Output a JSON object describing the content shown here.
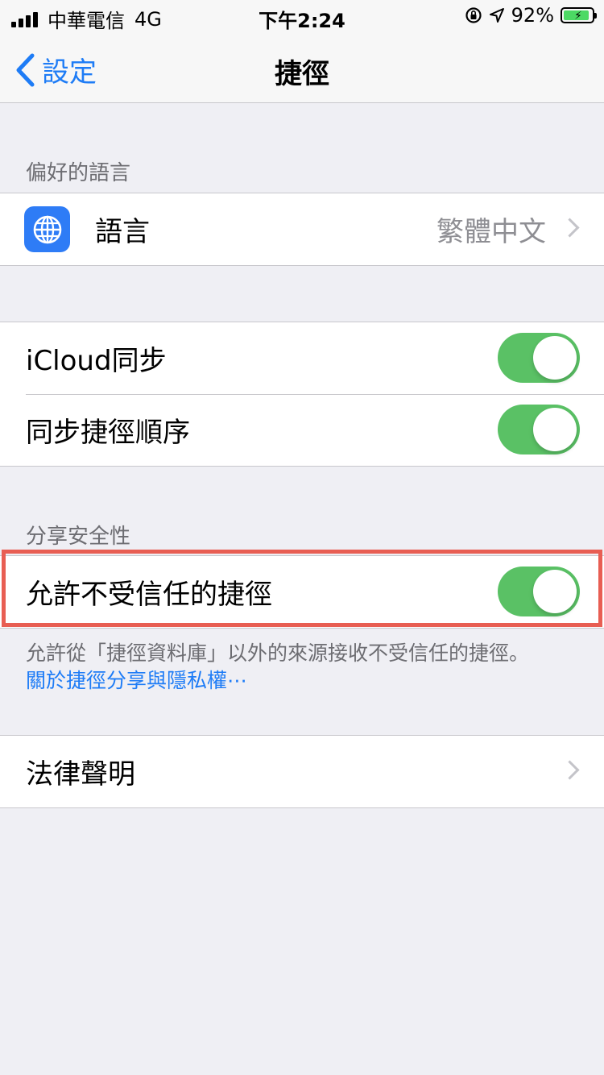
{
  "status_bar": {
    "carrier": "中華電信",
    "network": "4G",
    "time": "下午2:24",
    "battery_percent": "92%",
    "battery_level": 0.92,
    "battery_color": "#4cd964"
  },
  "nav": {
    "back_label": "設定",
    "title": "捷徑"
  },
  "sections": {
    "language_header": "偏好的語言",
    "language_row": {
      "label": "語言",
      "value": "繁體中文",
      "icon": "globe-icon"
    },
    "sync_rows": [
      {
        "label": "iCloud同步",
        "on": true
      },
      {
        "label": "同步捷徑順序",
        "on": true
      }
    ],
    "security_header": "分享安全性",
    "untrusted_row": {
      "label": "允許不受信任的捷徑",
      "on": true
    },
    "security_footer": "允許從「捷徑資料庫」以外的來源接收不受信任的捷徑。",
    "security_link": "關於捷徑分享與隱私權⋯",
    "legal_row": {
      "label": "法律聲明"
    }
  },
  "colors": {
    "accent": "#1e7cf6",
    "toggle_on": "#5ac165",
    "highlight": "#e85e53",
    "background": "#efeff4"
  }
}
